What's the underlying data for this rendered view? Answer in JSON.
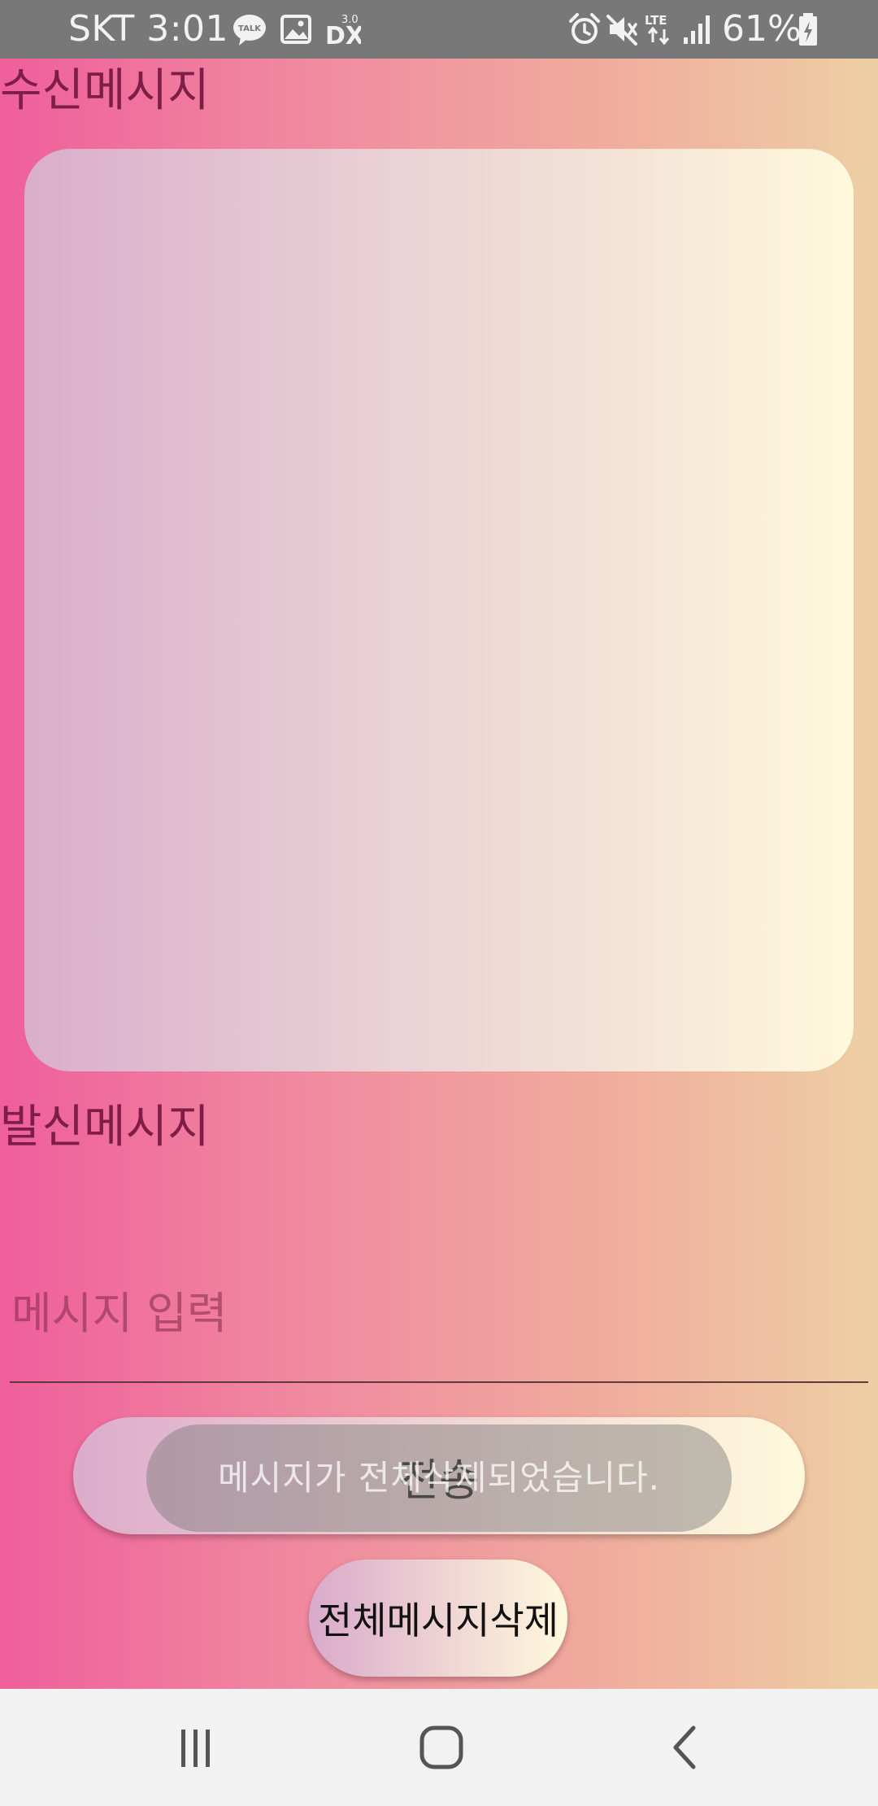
{
  "status_bar": {
    "carrier_time": "SKT 3:01",
    "battery_percent": "61%",
    "icons": [
      "talk-icon",
      "gallery-icon",
      "dx-icon",
      "alarm-icon",
      "mute-icon",
      "lte-icon",
      "signal-icon",
      "battery-icon"
    ]
  },
  "received": {
    "label": "수신메시지"
  },
  "sent": {
    "label": "발신메시지",
    "input_placeholder": "메시지 입력",
    "input_value": ""
  },
  "buttons": {
    "send_label": "전송",
    "delete_all_label": "전체메시지삭제"
  },
  "toast": {
    "text": "메시지가 전체삭제되었습니다."
  },
  "nav_bar": {
    "icons": [
      "recent-apps-icon",
      "home-icon",
      "back-icon"
    ]
  },
  "colors": {
    "status_bar": "#787878",
    "background_start": "#ef5f9b",
    "background_end": "#eecfa4",
    "label": "#7e1e46",
    "box_start": "#d9aeca",
    "box_end": "#fff9dc",
    "nav_bar": "#f2f2f2"
  }
}
